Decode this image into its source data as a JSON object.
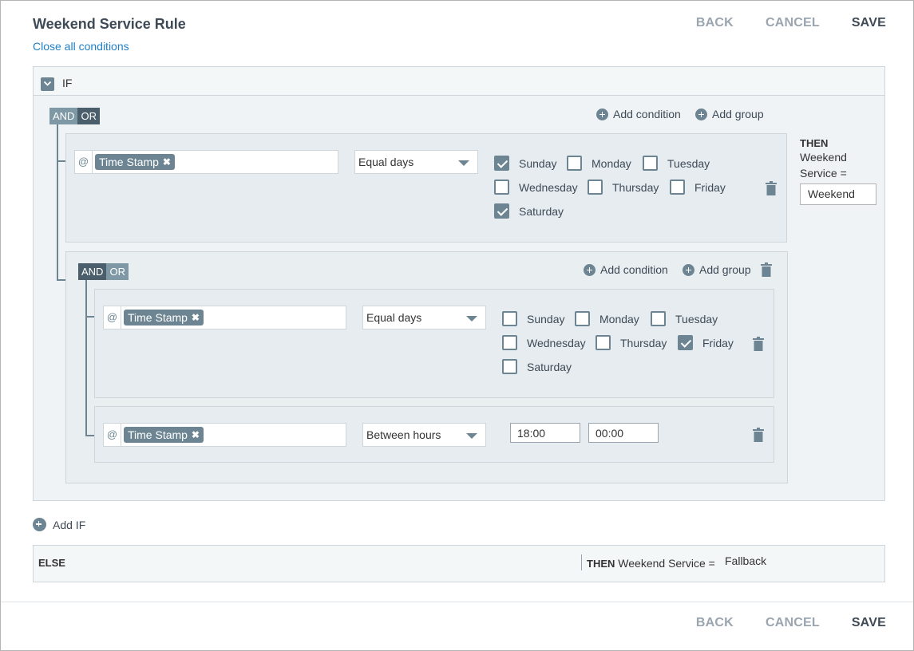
{
  "header": {
    "title": "Weekend Service Rule",
    "close_all": "Close all conditions",
    "back": "BACK",
    "cancel": "CANCEL",
    "save": "SAVE"
  },
  "if_block": {
    "label": "IF",
    "and": "AND",
    "or": "OR",
    "add_condition": "Add condition",
    "add_group": "Add group",
    "condition1": {
      "at": "@",
      "field": "Time Stamp",
      "operator": "Equal days",
      "days": [
        {
          "label": "Sunday",
          "checked": true
        },
        {
          "label": "Monday",
          "checked": false
        },
        {
          "label": "Tuesday",
          "checked": false
        },
        {
          "label": "Wednesday",
          "checked": false
        },
        {
          "label": "Thursday",
          "checked": false
        },
        {
          "label": "Friday",
          "checked": false
        },
        {
          "label": "Saturday",
          "checked": true
        }
      ]
    },
    "group": {
      "and": "AND",
      "or": "OR",
      "add_condition": "Add condition",
      "add_group": "Add group",
      "condition1": {
        "at": "@",
        "field": "Time Stamp",
        "operator": "Equal days",
        "days": [
          {
            "label": "Sunday",
            "checked": false
          },
          {
            "label": "Monday",
            "checked": false
          },
          {
            "label": "Tuesday",
            "checked": false
          },
          {
            "label": "Wednesday",
            "checked": false
          },
          {
            "label": "Thursday",
            "checked": false
          },
          {
            "label": "Friday",
            "checked": true
          },
          {
            "label": "Saturday",
            "checked": false
          }
        ]
      },
      "condition2": {
        "at": "@",
        "field": "Time Stamp",
        "operator": "Between hours",
        "from": "18:00",
        "to": "00:00"
      }
    },
    "then": {
      "title": "THEN",
      "field_line1": "Weekend",
      "field_line2": "Service =",
      "value": "Weekend"
    }
  },
  "add_if": "Add IF",
  "else_block": {
    "label": "ELSE",
    "then": "THEN",
    "field": "Weekend Service =",
    "value": "Fallback"
  },
  "footer": {
    "back": "BACK",
    "cancel": "CANCEL",
    "save": "SAVE"
  },
  "icons": {
    "plus": "plus-circle-icon",
    "trash": "trash-icon",
    "chevron": "chevron-down-icon"
  },
  "colors": {
    "accent": "#6d8593",
    "link": "#1f7fc7",
    "dark": "#3e4a56"
  }
}
